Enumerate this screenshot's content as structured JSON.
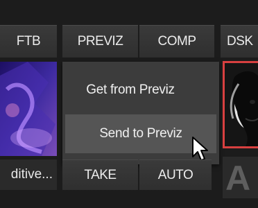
{
  "buttons": {
    "ftb": "FTB",
    "previz": "PREVIZ",
    "comp": "COMP",
    "dsk": "DSK",
    "take": "TAKE",
    "auto": "AUTO"
  },
  "left_thumb": {
    "caption": "ditive..."
  },
  "context_menu": {
    "items": [
      {
        "label": "Get from Previz"
      },
      {
        "label": "Send to Previz"
      }
    ]
  },
  "right_thumb": {
    "caption": "A"
  },
  "colors": {
    "background": "#1c1c1c",
    "button": "#353535",
    "menu": "#3c3c3c",
    "menu_highlight": "#555555",
    "selected_border": "#d84040"
  },
  "icons": {
    "cursor": "arrow-pointer-icon"
  }
}
